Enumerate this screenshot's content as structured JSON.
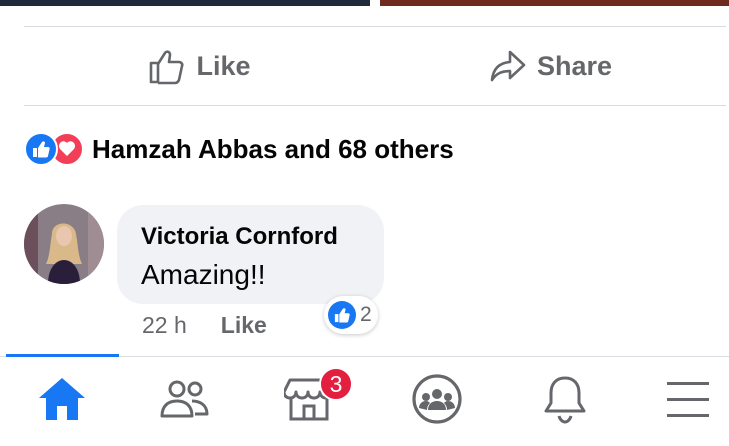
{
  "actions": {
    "like_label": "Like",
    "share_label": "Share"
  },
  "reactions": {
    "summary": "Hamzah Abbas and 68 others",
    "types": [
      "like",
      "love"
    ]
  },
  "comment": {
    "author": "Victoria Cornford",
    "text": "Amazing!!",
    "time": "22 h",
    "like_label": "Like",
    "reaction_type": "like",
    "reaction_count": "2"
  },
  "tabbar": {
    "active_tab": "home",
    "items": [
      {
        "name": "home",
        "icon": "home-icon"
      },
      {
        "name": "friends",
        "icon": "friends-icon"
      },
      {
        "name": "marketplace",
        "icon": "marketplace-icon",
        "badge": "3"
      },
      {
        "name": "groups",
        "icon": "groups-icon"
      },
      {
        "name": "notifications",
        "icon": "bell-icon"
      },
      {
        "name": "menu",
        "icon": "hamburger-menu-icon"
      }
    ]
  },
  "colors": {
    "accent": "#1877f2",
    "love": "#f33e58",
    "badge": "#e41e3f",
    "secondary_text": "#65676b",
    "bubble": "#f0f2f5"
  }
}
